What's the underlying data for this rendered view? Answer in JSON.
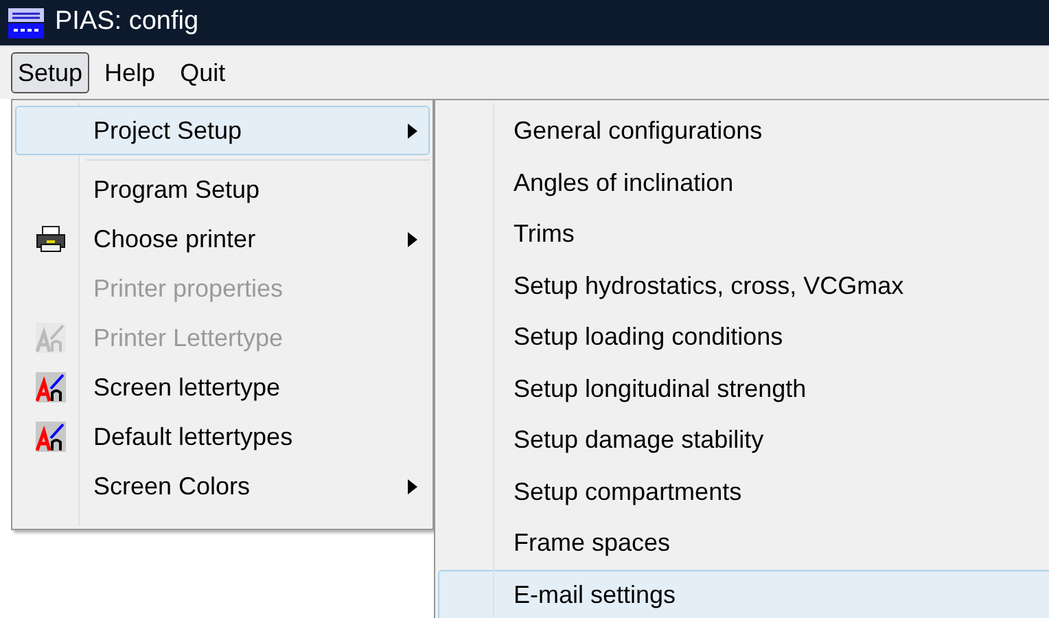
{
  "window": {
    "title": "PIAS: config"
  },
  "menu_bar": [
    {
      "label": "Setup",
      "selected": true
    },
    {
      "label": "Help",
      "selected": false
    },
    {
      "label": "Quit",
      "selected": false
    }
  ],
  "setup_menu": {
    "items": [
      {
        "kind": "plain",
        "label": "Project Setup",
        "selected": true,
        "disabled": false,
        "submenu": true
      },
      {
        "kind": "separator"
      },
      {
        "kind": "plain",
        "label": "Program Setup",
        "selected": false,
        "disabled": false,
        "submenu": false
      },
      {
        "kind": "printer",
        "label": "Choose printer",
        "selected": false,
        "disabled": false,
        "submenu": true
      },
      {
        "kind": "plain",
        "label": "Printer properties",
        "selected": false,
        "disabled": true,
        "submenu": false
      },
      {
        "kind": "font",
        "label": "Printer Lettertype",
        "selected": false,
        "disabled": true,
        "submenu": false
      },
      {
        "kind": "font",
        "label": "Screen lettertype",
        "selected": false,
        "disabled": false,
        "submenu": false
      },
      {
        "kind": "font",
        "label": "Default lettertypes",
        "selected": false,
        "disabled": false,
        "submenu": false
      },
      {
        "kind": "plain",
        "label": "Screen Colors",
        "selected": false,
        "disabled": false,
        "submenu": true
      }
    ]
  },
  "project_setup_menu": {
    "items": [
      {
        "label": "General configurations",
        "selected": false
      },
      {
        "label": "Angles of inclination",
        "selected": false
      },
      {
        "label": "Trims",
        "selected": false
      },
      {
        "label": "Setup hydrostatics, cross, VCGmax",
        "selected": false
      },
      {
        "label": "Setup loading conditions",
        "selected": false
      },
      {
        "label": "Setup longitudinal strength",
        "selected": false
      },
      {
        "label": "Setup damage stability",
        "selected": false
      },
      {
        "label": "Setup compartments",
        "selected": false
      },
      {
        "label": "Frame spaces",
        "selected": false
      },
      {
        "label": "E-mail settings",
        "selected": true
      }
    ]
  }
}
